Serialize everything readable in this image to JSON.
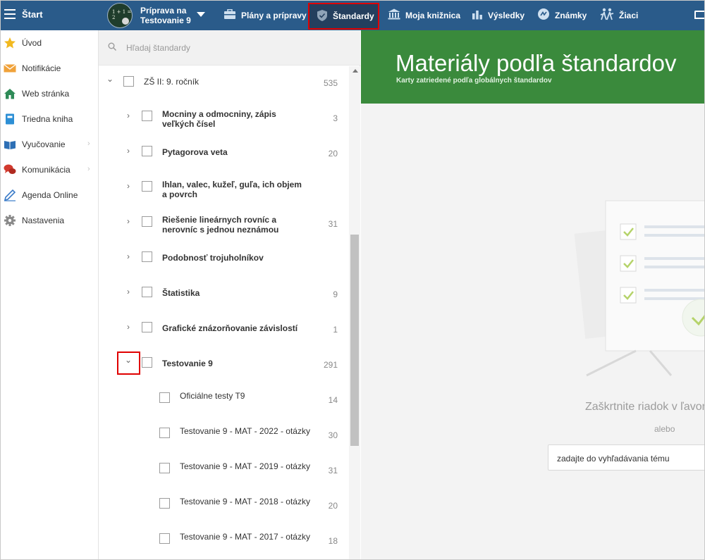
{
  "topbar": {
    "start_label": "Štart",
    "course_title_line1": "Príprava na",
    "course_title_line2": "Testovanie 9",
    "course_avatar_text": "1 + 1 = 2",
    "nav": [
      {
        "label": "Plány a prípravy",
        "icon": "briefcase-icon"
      },
      {
        "label": "Štandardy",
        "icon": "shield-icon",
        "active": true
      },
      {
        "label": "Moja knižnica",
        "icon": "library-icon"
      },
      {
        "label": "Výsledky",
        "icon": "bar-chart-icon"
      },
      {
        "label": "Známky",
        "icon": "grades-icon"
      },
      {
        "label": "Žiaci",
        "icon": "students-icon"
      }
    ],
    "colors": {
      "bar": "#2a5b8a",
      "active_tab": "#243f5e",
      "highlight": "#e00000"
    }
  },
  "sidebar": {
    "items": [
      {
        "label": "Úvod",
        "icon": "star-icon"
      },
      {
        "label": "Notifikácie",
        "icon": "envelope-icon"
      },
      {
        "label": "Web stránka",
        "icon": "home-icon"
      },
      {
        "label": "Triedna kniha",
        "icon": "book-icon"
      },
      {
        "label": "Vyučovanie",
        "icon": "open-book-icon",
        "arrow": "›"
      },
      {
        "label": "Komunikácia",
        "icon": "chat-icon",
        "arrow": "›"
      },
      {
        "label": "Agenda Online",
        "icon": "pen-icon"
      },
      {
        "label": "Nastavenia",
        "icon": "gear-icon"
      }
    ]
  },
  "tree": {
    "search_placeholder": "Hľadaj štandardy",
    "root": {
      "label": "ZŠ II: 9. ročník",
      "count": "535",
      "chevron": "⌄"
    },
    "children": [
      {
        "label_l1": "Mocniny a odmocniny, zápis",
        "label_l2": "veľkých čísel",
        "count": "3"
      },
      {
        "label_l1": "Pytagorova veta",
        "label_l2": "",
        "count": "20"
      },
      {
        "label_l1": "Ihlan, valec, kužeľ, guľa, ich objem",
        "label_l2": "a povrch",
        "count": ""
      },
      {
        "label_l1": "Riešenie lineárnych rovníc a",
        "label_l2": "nerovníc s jednou neznámou",
        "count": "31"
      },
      {
        "label_l1": "Podobnosť trojuholníkov",
        "label_l2": "",
        "count": ""
      },
      {
        "label_l1": "Štatistika",
        "label_l2": "",
        "count": "9"
      },
      {
        "label_l1": "Grafické znázorňovanie závislostí",
        "label_l2": "",
        "count": "1"
      },
      {
        "label_l1": "Testovanie 9",
        "label_l2": "",
        "count": "291"
      }
    ],
    "collapsed_chevron": "›",
    "expanded_chevron": "⌄",
    "subitems": [
      {
        "label": "Oficiálne testy T9",
        "count": "14"
      },
      {
        "label": "Testovanie 9 - MAT - 2022 - otázky",
        "count": "30"
      },
      {
        "label": "Testovanie 9 - MAT - 2019 - otázky",
        "count": "31"
      },
      {
        "label": "Testovanie 9 - MAT - 2018 - otázky",
        "count": "20"
      },
      {
        "label": "Testovanie 9 - MAT - 2017 - otázky",
        "count": "18"
      }
    ]
  },
  "content": {
    "title": "Materiály podľa štandardov",
    "subtitle": "Karty zatriedené podľa globálnych štandardov",
    "hint": "Zaškrtnite riadok v ľavom",
    "or": "alebo",
    "topic_placeholder": "zadajte do vyhľadávania tému",
    "banner_color": "#3a8a3c"
  }
}
